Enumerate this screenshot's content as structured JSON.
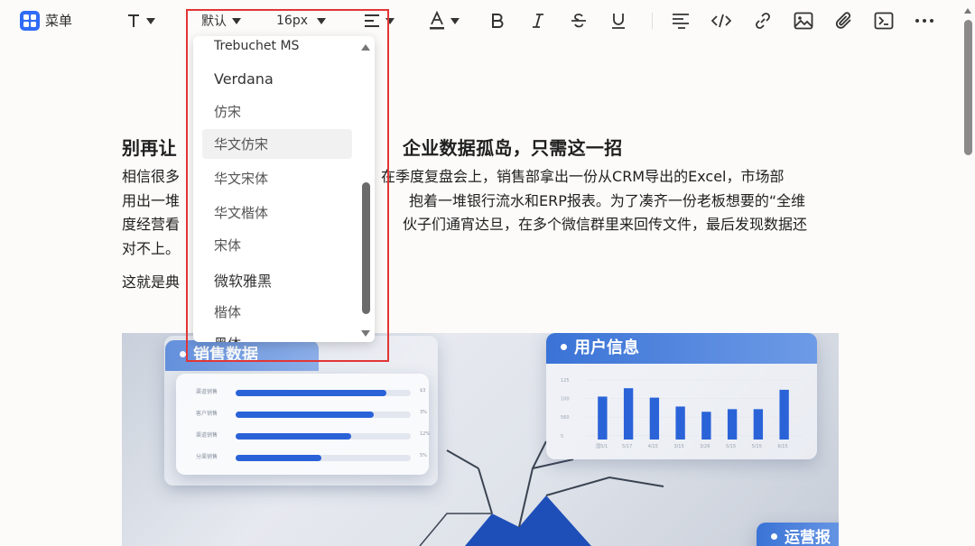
{
  "toolbar": {
    "menu_label": "菜单",
    "font_family_value": "默认",
    "font_size_value": "16px"
  },
  "document": {
    "title_left": "别再让",
    "title_right": "企业数据孤岛，只需这一招",
    "para_lines": [
      "相信很多",
      "在季度复盘会上，销售部拿出一份从CRM导出的Excel，市场部",
      "用出一堆",
      "抱着一堆银行流水和ERP报表。为了凑齐一份老板想要的“全维",
      "度经营看",
      "伙子们通宵达旦，在多个微信群里来回传文件，最后发现数据还",
      "对不上。"
    ],
    "para2": "这就是典"
  },
  "illustration": {
    "card_sales_title": "销售数据",
    "card_users_title": "用户信息",
    "card_ops_title": "运营报",
    "colors": {
      "header": "#3a73d6",
      "bar": "#2a63d8"
    },
    "sales_rows": [
      {
        "label": "渠道销售",
        "value": 0.86,
        "val_text": "$3"
      },
      {
        "label": "客户销售",
        "value": 0.79,
        "val_text": "3%"
      },
      {
        "label": "渠道销售",
        "value": 0.66,
        "val_text": "12%"
      },
      {
        "label": "分渠销售",
        "value": 0.49,
        "val_text": "5%"
      }
    ],
    "users_chart": {
      "type": "bar",
      "categories": [
        "国5/1",
        "5/17",
        "4/15",
        "3/15",
        "3/26",
        "5/15",
        "5/15",
        "6/15"
      ],
      "values": [
        82,
        98,
        80,
        63,
        53,
        58,
        58,
        95
      ],
      "ylim": [
        0,
        100
      ],
      "yticks": [
        "125",
        "100",
        "560",
        "5"
      ]
    }
  },
  "dropdown": {
    "options": [
      {
        "label": "Trebuchet MS",
        "font": "sans",
        "size": 14,
        "top": -6,
        "color": "#333"
      },
      {
        "label": "Verdana",
        "font": "sans",
        "size": 16,
        "top": 31,
        "color": "#333"
      },
      {
        "label": "仿宋",
        "font": "serif",
        "size": 15,
        "top": 67,
        "color": "#555"
      },
      {
        "label": "华文仿宋",
        "font": "serif",
        "size": 15,
        "top": 103,
        "color": "#555",
        "highlight": true
      },
      {
        "label": "华文宋体",
        "font": "serif",
        "size": 15,
        "top": 141,
        "color": "#555"
      },
      {
        "label": "华文楷体",
        "font": "serif",
        "size": 15,
        "top": 179,
        "color": "#555"
      },
      {
        "label": "宋体",
        "font": "serif",
        "size": 15,
        "top": 215,
        "color": "#555"
      },
      {
        "label": "微软雅黑",
        "font": "sans",
        "size": 16,
        "top": 253,
        "color": "#333"
      },
      {
        "label": "楷体",
        "font": "serif",
        "size": 15,
        "top": 289,
        "color": "#555"
      },
      {
        "label": "黑体",
        "font": "sans",
        "size": 15,
        "top": 324,
        "color": "#333"
      }
    ]
  }
}
